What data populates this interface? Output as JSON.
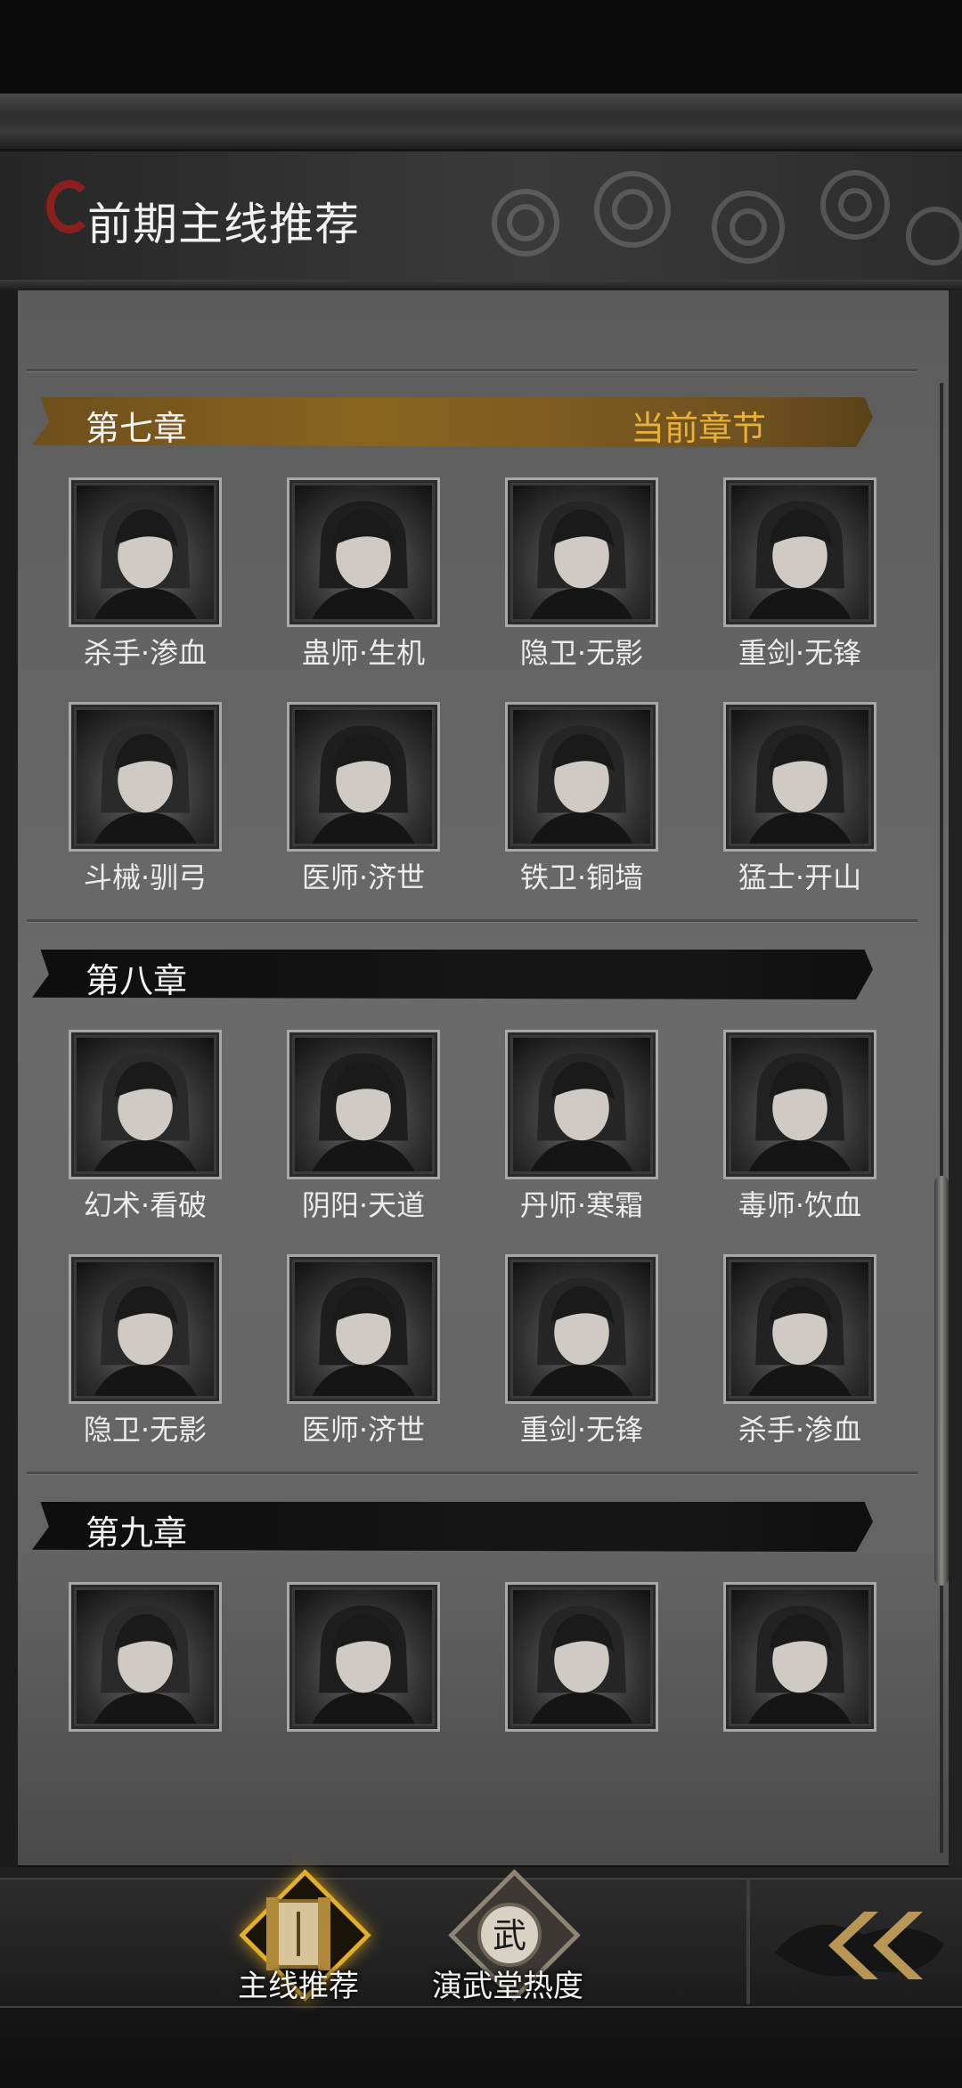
{
  "header": {
    "title": "前期主线推荐"
  },
  "chapters": [
    {
      "name": "第七章",
      "current_label": "当前章节",
      "heroes": [
        "杀手·渗血",
        "蛊师·生机",
        "隐卫·无影",
        "重剑·无锋",
        "斗械·驯弓",
        "医师·济世",
        "铁卫·铜墙",
        "猛士·开山"
      ]
    },
    {
      "name": "第八章",
      "heroes": [
        "幻术·看破",
        "阴阳·天道",
        "丹师·寒霜",
        "毒师·饮血",
        "隐卫·无影",
        "医师·济世",
        "重剑·无锋",
        "杀手·渗血"
      ]
    },
    {
      "name": "第九章",
      "heroes": [
        "",
        "",
        "",
        ""
      ]
    }
  ],
  "nav": {
    "main_quest_label": "主线推荐",
    "arena_label": "演武堂热度",
    "arena_glyph": "武"
  },
  "colors": {
    "accent_gold": "#e2ae2e",
    "current_chapter": "#e8b23a",
    "title_mark": "#8a1f1f"
  }
}
